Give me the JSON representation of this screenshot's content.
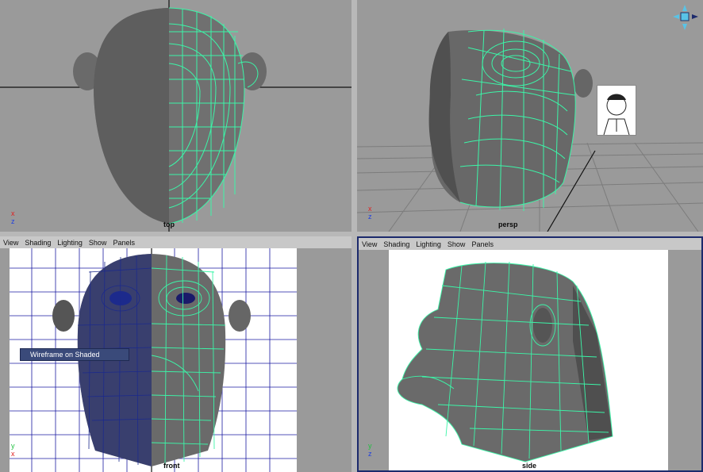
{
  "viewports": {
    "top": {
      "camera_label": "top"
    },
    "persp": {
      "camera_label": "persp"
    },
    "front": {
      "camera_label": "front",
      "menu": [
        "View",
        "Shading",
        "Lighting",
        "Show",
        "Panels"
      ],
      "popup": "Wireframe on Shaded"
    },
    "side": {
      "camera_label": "side",
      "menu": [
        "View",
        "Shading",
        "Lighting",
        "Show",
        "Panels"
      ]
    }
  },
  "axes": {
    "top": {
      "a": "x",
      "b": "z"
    },
    "persp": {
      "a": "x",
      "b": "z"
    },
    "front": {
      "a": "x",
      "b": "y"
    },
    "side": {
      "a": "z",
      "b": "y"
    }
  },
  "colors": {
    "viewport_bg": "#9a9a9a",
    "ortho_bg": "#ffffff",
    "wire_green": "#3cf5a8",
    "wire_blue": "#1c2a8c",
    "mesh_gray": "#6a6a6a",
    "menu_bg": "#c8c8c8",
    "grid_dark": "#1a1aa0"
  }
}
